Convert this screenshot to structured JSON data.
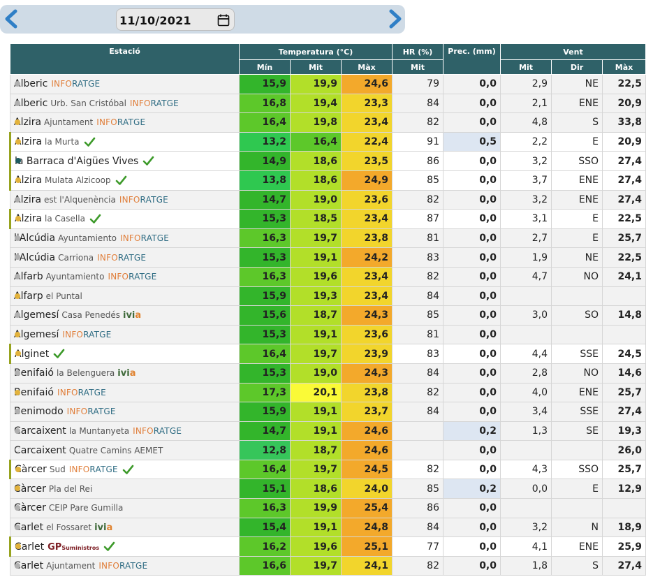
{
  "date": "11/10/2021",
  "columns": {
    "estacio": "Estació",
    "temperatura": "Temperatura (°C)",
    "hr": "HR (%)",
    "prec": "Prec. (mm)",
    "vent": "Vent",
    "t_min": "Mín",
    "t_mit": "Mit",
    "t_max": "Màx",
    "hr_mit": "Mit",
    "v_mit": "Mit",
    "v_dir": "Dir",
    "v_max": "Màx"
  },
  "colors": {
    "header_bg": "#2f6168",
    "temp_scale": {
      "12.8": "#36c55a",
      "13.2": "#2fc850",
      "13.8": "#2fc850",
      "14.7": "#33b52b",
      "14.9": "#33b52b",
      "15.1": "#33b52b",
      "15.3": "#33b52b",
      "15.4": "#33b52b",
      "15.6": "#33b52b",
      "15.9": "#33b52b",
      "16.2": "#5dc82a",
      "16.3": "#5dc82a",
      "16.4": "#5dc82a",
      "16.6": "#5dc82a",
      "16.8": "#5dc82a",
      "17.3": "#5dc82a",
      "18.5": "#b2df29",
      "18.6": "#b2df29",
      "18.7": "#b2df29",
      "19.0": "#b2df29",
      "19.1": "#b2df29",
      "19.2": "#b2df29",
      "19.3": "#b2df29",
      "19.4": "#b2df29",
      "19.6": "#b2df29",
      "19.7": "#b2df29",
      "19.8": "#b2df29",
      "19.9": "#b2df29",
      "20.1": "#fafa37",
      "22.4": "#f2d52c",
      "22.5": "#f2d52c",
      "23.3": "#f2d52c",
      "23.4": "#f2d52c",
      "23.5": "#f2d52c",
      "23.6": "#f2d52c",
      "23.7": "#f2d52c",
      "23.8": "#f2d52c",
      "23.9": "#f2d52c",
      "24.0": "#f2d52c",
      "24.1": "#f2d52c",
      "24.2": "#f3a92b",
      "24.3": "#f3a92b",
      "24.5": "#f3a92b",
      "24.6": "#f3a92b",
      "24.8": "#f3a92b",
      "24.9": "#f3a92b",
      "25.1": "#f3a92b",
      "25.4": "#f3a92b"
    }
  },
  "stations": [
    {
      "dot": "grey",
      "name": "Alberic",
      "loc": "",
      "tag": "inforatge",
      "check": false,
      "min": "15,9",
      "mit": "19,9",
      "max": "24,6",
      "hr": "79",
      "prec": "0,0",
      "wet": false,
      "vmit": "2,9",
      "dir": "NE",
      "vmax": "22,5"
    },
    {
      "dot": "grey",
      "name": "Alberic",
      "loc": "Urb. San Cristóbal",
      "tag": "inforatge",
      "check": false,
      "min": "16,8",
      "mit": "19,4",
      "max": "23,3",
      "hr": "84",
      "prec": "0,0",
      "wet": false,
      "vmit": "2,1",
      "dir": "ENE",
      "vmax": "20,9"
    },
    {
      "dot": "yellow",
      "name": "Alzira",
      "loc": "Ajuntament",
      "tag": "inforatge",
      "check": false,
      "min": "16,4",
      "mit": "19,8",
      "max": "23,4",
      "hr": "82",
      "prec": "0,0",
      "wet": false,
      "vmit": "4,8",
      "dir": "S",
      "vmax": "33,8"
    },
    {
      "dot": "yellow",
      "name": "Alzira",
      "loc": "la Murta",
      "tag": "",
      "check": true,
      "min": "13,2",
      "mit": "16,4",
      "max": "22,4",
      "hr": "91",
      "prec": "0,5",
      "wet": true,
      "vmit": "2,2",
      "dir": "E",
      "vmax": "20,9"
    },
    {
      "dot": "teal",
      "name": "la Barraca d'Aigües Vives",
      "loc": "",
      "tag": "",
      "check": true,
      "min": "14,9",
      "mit": "18,6",
      "max": "23,5",
      "hr": "86",
      "prec": "0,0",
      "wet": false,
      "vmit": "3,2",
      "dir": "SSO",
      "vmax": "27,4"
    },
    {
      "dot": "yellow",
      "name": "Alzira",
      "loc": "Mulata Alzicoop",
      "tag": "",
      "check": true,
      "min": "13,8",
      "mit": "18,6",
      "max": "24,9",
      "hr": "85",
      "prec": "0,0",
      "wet": false,
      "vmit": "3,7",
      "dir": "ENE",
      "vmax": "27,4"
    },
    {
      "dot": "grey",
      "name": "Alzira",
      "loc": "est l'Alquenència",
      "tag": "inforatge",
      "check": false,
      "min": "14,7",
      "mit": "19,0",
      "max": "23,6",
      "hr": "82",
      "prec": "0,0",
      "wet": false,
      "vmit": "3,2",
      "dir": "ENE",
      "vmax": "27,4"
    },
    {
      "dot": "yellow",
      "name": "Alzira",
      "loc": "la Casella",
      "tag": "",
      "check": true,
      "min": "15,3",
      "mit": "18,5",
      "max": "23,4",
      "hr": "87",
      "prec": "0,0",
      "wet": false,
      "vmit": "3,1",
      "dir": "E",
      "vmax": "22,5"
    },
    {
      "dot": "grey",
      "name": "l'Alcúdia",
      "loc": "Ayuntamiento",
      "tag": "inforatge",
      "check": false,
      "min": "16,3",
      "mit": "19,7",
      "max": "23,8",
      "hr": "81",
      "prec": "0,0",
      "wet": false,
      "vmit": "2,7",
      "dir": "E",
      "vmax": "25,7"
    },
    {
      "dot": "grey",
      "name": "l'Alcúdia",
      "loc": "Carriona",
      "tag": "inforatge",
      "check": false,
      "min": "15,3",
      "mit": "19,1",
      "max": "24,2",
      "hr": "83",
      "prec": "0,0",
      "wet": false,
      "vmit": "1,9",
      "dir": "NE",
      "vmax": "22,5"
    },
    {
      "dot": "grey",
      "name": "Alfarb",
      "loc": "Ayuntamiento",
      "tag": "inforatge",
      "check": false,
      "min": "16,3",
      "mit": "19,6",
      "max": "23,4",
      "hr": "82",
      "prec": "0,0",
      "wet": false,
      "vmit": "4,7",
      "dir": "NO",
      "vmax": "24,1"
    },
    {
      "dot": "yellow",
      "name": "Alfarp",
      "loc": "el Puntal",
      "tag": "",
      "check": false,
      "min": "15,9",
      "mit": "19,3",
      "max": "23,4",
      "hr": "84",
      "prec": "0,0",
      "wet": false,
      "vmit": "",
      "dir": "",
      "vmax": ""
    },
    {
      "dot": "grey",
      "name": "Algemesí",
      "loc": "Casa Penedés",
      "tag": "ivia",
      "check": false,
      "min": "15,6",
      "mit": "18,7",
      "max": "24,3",
      "hr": "85",
      "prec": "0,0",
      "wet": false,
      "vmit": "3,0",
      "dir": "SO",
      "vmax": "14,8"
    },
    {
      "dot": "yellow",
      "name": "Algemesí",
      "loc": "",
      "tag": "inforatge",
      "check": false,
      "min": "15,3",
      "mit": "19,1",
      "max": "23,6",
      "hr": "81",
      "prec": "0,0",
      "wet": false,
      "vmit": "",
      "dir": "",
      "vmax": ""
    },
    {
      "dot": "yellow",
      "name": "Alginet",
      "loc": "",
      "tag": "",
      "check": true,
      "min": "16,4",
      "mit": "19,7",
      "max": "23,9",
      "hr": "83",
      "prec": "0,0",
      "wet": false,
      "vmit": "4,4",
      "dir": "SSE",
      "vmax": "24,5"
    },
    {
      "dot": "grey",
      "name": "Benifaió",
      "loc": "la Belenguera",
      "tag": "ivia",
      "check": false,
      "min": "15,3",
      "mit": "19,0",
      "max": "24,3",
      "hr": "84",
      "prec": "0,0",
      "wet": false,
      "vmit": "2,8",
      "dir": "NO",
      "vmax": "14,6"
    },
    {
      "dot": "yellow",
      "name": "Benifaió",
      "loc": "",
      "tag": "inforatge",
      "check": false,
      "min": "17,3",
      "mit": "20,1",
      "max": "23,8",
      "hr": "82",
      "prec": "0,0",
      "wet": false,
      "vmit": "4,0",
      "dir": "ENE",
      "vmax": "25,7"
    },
    {
      "dot": "grey",
      "name": "Benimodo",
      "loc": "",
      "tag": "inforatge",
      "check": false,
      "min": "15,9",
      "mit": "19,1",
      "max": "23,7",
      "hr": "84",
      "prec": "0,0",
      "wet": false,
      "vmit": "3,4",
      "dir": "SSE",
      "vmax": "27,4"
    },
    {
      "dot": "grey",
      "name": "Carcaixent",
      "loc": "la Muntanyeta",
      "tag": "inforatge",
      "check": false,
      "min": "14,7",
      "mit": "19,1",
      "max": "24,6",
      "hr": "",
      "prec": "0,2",
      "wet": true,
      "vmit": "1,3",
      "dir": "SE",
      "vmax": "19,3"
    },
    {
      "dot": "hollow",
      "name": "Carcaixent",
      "loc": "Quatre Camins AEMET",
      "tag": "",
      "check": false,
      "min": "12,8",
      "mit": "18,7",
      "max": "24,6",
      "hr": "",
      "prec": "0,0",
      "wet": false,
      "vmit": "",
      "dir": "",
      "vmax": "26,0"
    },
    {
      "dot": "yellow",
      "name": "Càrcer",
      "loc": "Sud",
      "tag": "inforatge",
      "check": true,
      "min": "16,4",
      "mit": "19,7",
      "max": "24,5",
      "hr": "82",
      "prec": "0,0",
      "wet": false,
      "vmit": "4,3",
      "dir": "SSO",
      "vmax": "25,7"
    },
    {
      "dot": "yellow",
      "name": "Càrcer",
      "loc": "Pla del Rei",
      "tag": "",
      "check": false,
      "min": "15,1",
      "mit": "18,6",
      "max": "24,0",
      "hr": "85",
      "prec": "0,2",
      "wet": true,
      "vmit": "0,0",
      "dir": "E",
      "vmax": "12,9"
    },
    {
      "dot": "grey",
      "name": "Càrcer",
      "loc": "CEIP Pare Gumilla",
      "tag": "",
      "check": false,
      "min": "16,3",
      "mit": "19,9",
      "max": "25,4",
      "hr": "86",
      "prec": "0,0",
      "wet": false,
      "vmit": "",
      "dir": "",
      "vmax": ""
    },
    {
      "dot": "grey",
      "name": "Carlet",
      "loc": "el Fossaret",
      "tag": "ivia",
      "check": false,
      "min": "15,4",
      "mit": "19,1",
      "max": "24,8",
      "hr": "84",
      "prec": "0,0",
      "wet": false,
      "vmit": "3,2",
      "dir": "N",
      "vmax": "18,9"
    },
    {
      "dot": "yellow",
      "name": "Carlet",
      "loc": "",
      "tag": "gp",
      "check": true,
      "min": "16,2",
      "mit": "19,6",
      "max": "25,1",
      "hr": "77",
      "prec": "0,0",
      "wet": false,
      "vmit": "4,1",
      "dir": "ENE",
      "vmax": "25,9"
    },
    {
      "dot": "grey",
      "name": "Carlet",
      "loc": "Ajuntament",
      "tag": "inforatge",
      "check": false,
      "min": "16,6",
      "mit": "19,7",
      "max": "24,1",
      "hr": "82",
      "prec": "0,0",
      "wet": false,
      "vmit": "1,8",
      "dir": "S",
      "vmax": "27,4"
    }
  ],
  "logos": {
    "inforatge_a": "INFO",
    "inforatge_b": "RATGE",
    "ivia_a": "ivi",
    "ivia_b": "a",
    "gp_a": "GP",
    "gp_b": "Suministros"
  }
}
